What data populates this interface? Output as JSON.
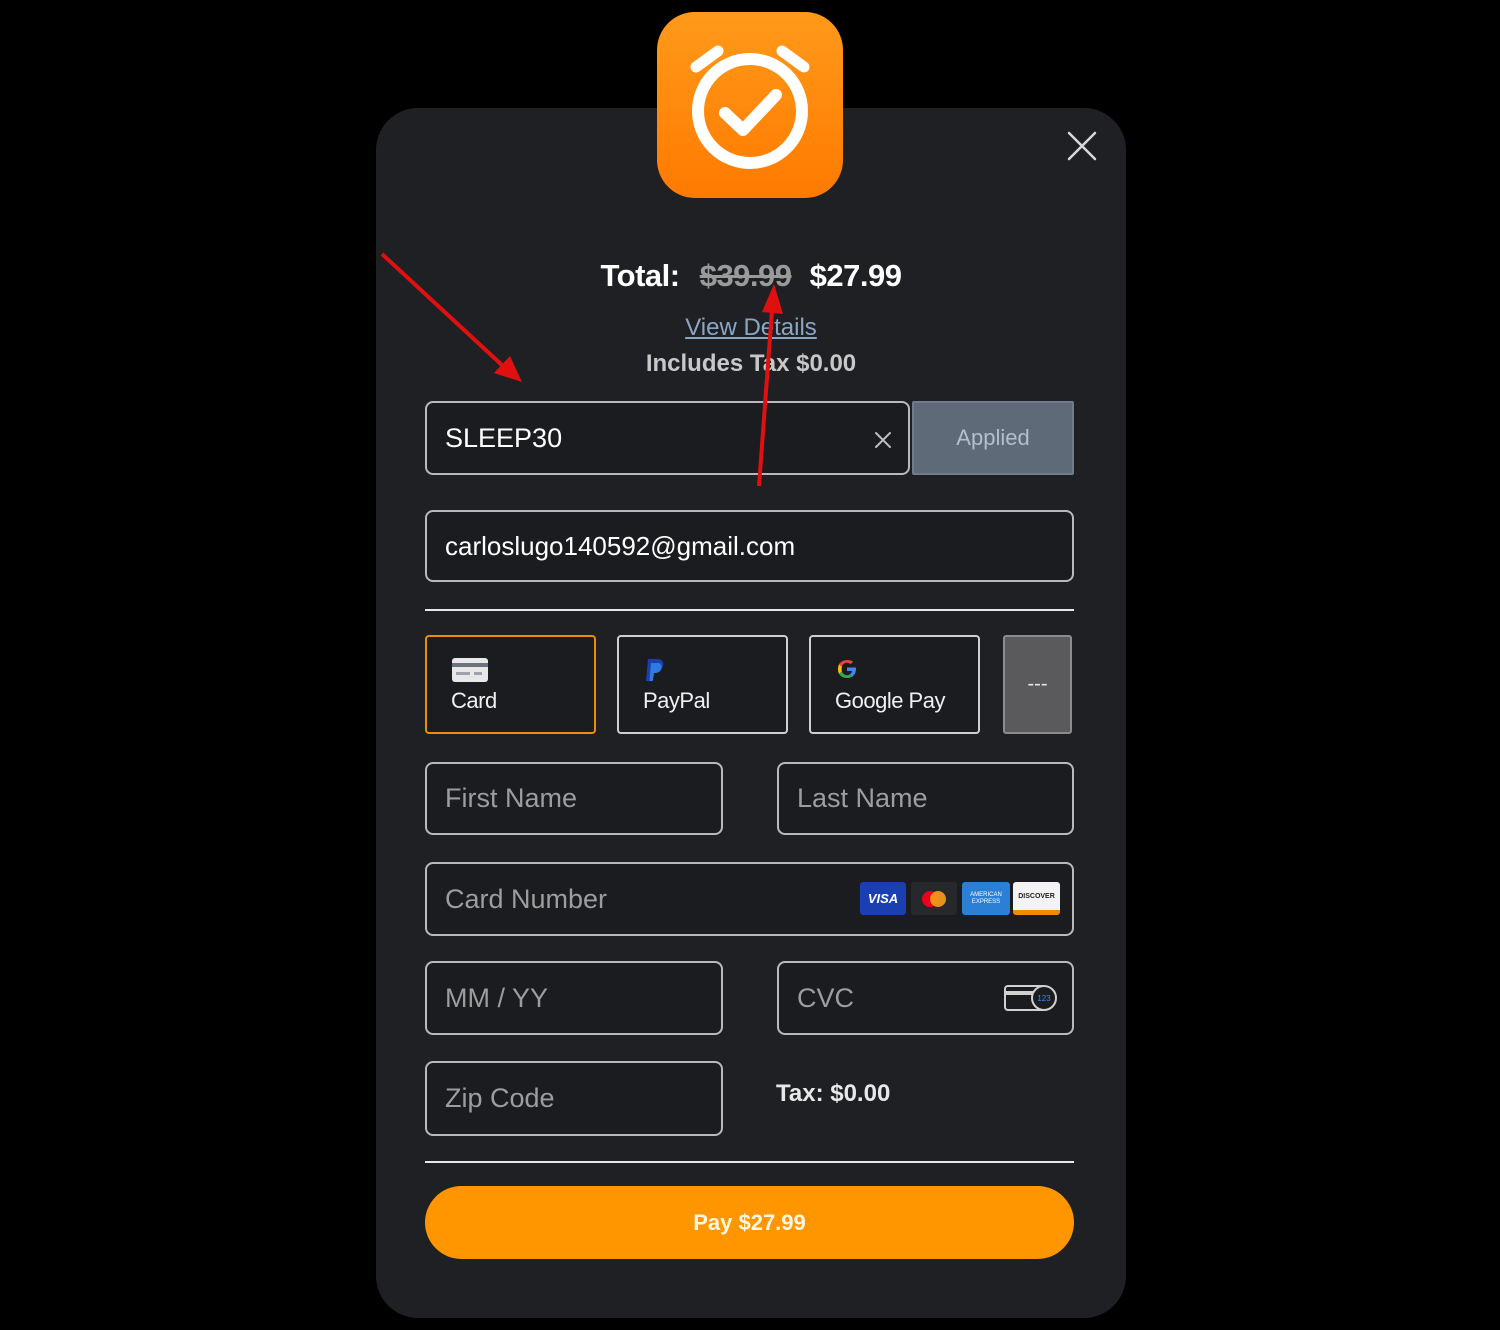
{
  "checkout": {
    "total_label": "Total:",
    "original_price": "$39.99",
    "discounted_price": "$27.99",
    "view_details": "View Details",
    "includes_tax": "Includes Tax $0.00"
  },
  "promo": {
    "code": "SLEEP30",
    "status_button": "Applied"
  },
  "email": {
    "value": "carloslugo140592@gmail.com"
  },
  "payment_methods": [
    {
      "label": "Card",
      "icon": "credit-card-icon",
      "selected": true
    },
    {
      "label": "PayPal",
      "icon": "paypal-icon",
      "selected": false
    },
    {
      "label": "Google Pay",
      "icon": "google-icon",
      "selected": false
    }
  ],
  "more_methods_label": "---",
  "form": {
    "first_name_placeholder": "First Name",
    "last_name_placeholder": "Last Name",
    "card_number_placeholder": "Card Number",
    "expiry_placeholder": "MM / YY",
    "cvc_placeholder": "CVC",
    "zip_placeholder": "Zip Code",
    "card_brands": {
      "visa": "VISA",
      "mastercard": "mastercard",
      "amex": "AMERICAN EXPRESS",
      "discover": "DISCOVER"
    },
    "cvc_hint": "123"
  },
  "tax_summary": "Tax: $0.00",
  "pay_button": "Pay $27.99",
  "colors": {
    "accent": "#ff9600",
    "selected_border": "#f08c00",
    "modal_bg": "#1f2023",
    "annotation_arrow": "#e01010"
  }
}
